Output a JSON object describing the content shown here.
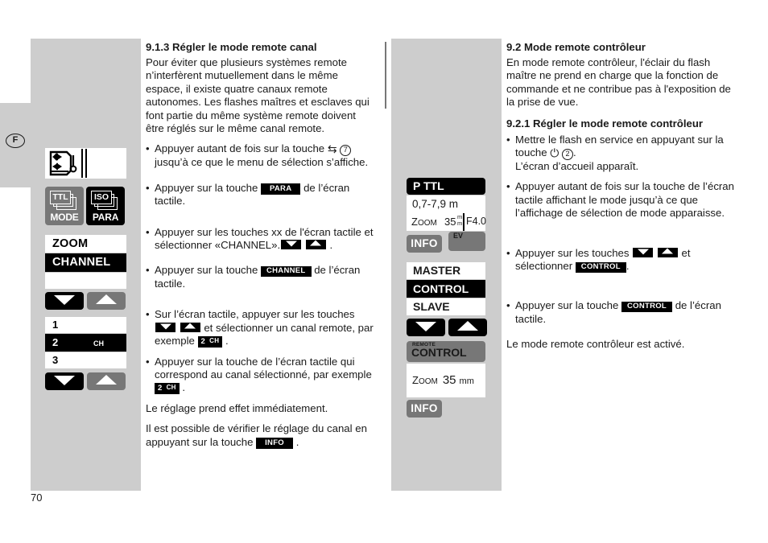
{
  "page": {
    "number": "70",
    "country_marker": "F"
  },
  "left_column": {
    "heading": "9.1.3  Régler le mode remote canal",
    "intro": "Pour éviter que plusieurs systèmes remote n’interfèrent mutuellement dans le même espace, il existe quatre canaux remote autonomes. Les flashes maîtres et esclaves qui font partie du même système remote doivent être réglés sur le même canal remote.",
    "bullet1_a": "Appuyer autant de fois sur la touche",
    "bullet1_sym": "⇆",
    "bullet1_num": "7",
    "bullet1_b": "jusqu’à ce que le menu de sélection s’affiche.",
    "bullet2_a": "Appuyer sur la touche",
    "bullet2_badge": "PARA",
    "bullet2_b": "de l’écran tactile.",
    "bullet3_a": "Appuyer sur les touches xx de l'écran tactile et sélectionner «CHANNEL».",
    "bullet3_b": ".",
    "bullet4_a": "Appuyer sur la touche",
    "bullet4_badge": "CHANNEL",
    "bullet4_b": "de l’écran tactile.",
    "bullet5_a": "Sur l’écran tactile, appuyer sur les touches",
    "bullet5_b": "et sélectionner un canal remote, par exemple",
    "bullet5_badge_num": "2",
    "bullet5_badge_ch": "CH",
    "bullet5_c": ".",
    "bullet6_a": "Appuyer sur la touche de l’écran tactile qui correspond au canal sélectionné, par exemple",
    "bullet6_badge_num": "2",
    "bullet6_badge_ch": "CH",
    "bullet6_b": ".",
    "closing1": "Le réglage prend effet immédiatement.",
    "closing2_a": "Il est possible de vérifier le réglage du canal en appuyant sur la touche",
    "closing2_badge": "INFO",
    "closing2_b": "."
  },
  "right_column": {
    "heading": "9.2 Mode remote contrôleur",
    "intro": "En mode remote contrôleur, l'éclair du flash maître ne prend en charge que la fonction de commande et ne contribue pas à l'exposition de la prise de vue.",
    "subheading": "9.2.1 Régler le mode remote contrôleur",
    "bullet1_a": "Mettre le flash en service en appuyant sur la touche",
    "bullet1_sym": "⏻",
    "bullet1_num": "2",
    "bullet1_b": ".",
    "bullet1_c": "L’écran d’accueil apparaît.",
    "bullet2": "Appuyer autant de fois sur la touche de l’écran tactile affichant le mode jusqu’à ce que l’affichage de sélection de mode apparaisse.",
    "bullet3_a": "Appuyer sur les touches",
    "bullet3_b": "et sélectionner",
    "bullet3_badge": "CONTROL",
    "bullet3_c": ".",
    "bullet4_a": "Appuyer sur la touche",
    "bullet4_badge": "CONTROL",
    "bullet4_b": "de l’écran tactile.",
    "closing": "Le mode remote contrôleur est activé."
  },
  "left_panel_lcd": {
    "reflector_icon_name": "reflector-zoom-icon",
    "mode_key": {
      "top": "TTL",
      "bottom": "MODE"
    },
    "para_key": {
      "top": "ISO",
      "bottom": "PARA"
    },
    "menu_list": [
      "ZOOM",
      "CHANNEL",
      ""
    ],
    "menu_selected": "CHANNEL",
    "channel_list": [
      "1",
      "2",
      "3"
    ],
    "channel_selected": "2",
    "channel_suffix": "CH"
  },
  "middle_panel_lcd": {
    "mode_bar": "P TTL",
    "distance": "0,7-7,9 m",
    "zoom_label": "Zoom",
    "zoom_value": "35",
    "zoom_unit_top": "m",
    "zoom_unit_bottom": "m",
    "aperture": "F4.0",
    "info_label": "INFO",
    "ev_label": "EV",
    "mode_list": [
      "MASTER",
      "CONTROL",
      "SLAVE"
    ],
    "mode_selected": "CONTROL",
    "remote_sup": "REMOTE",
    "remote_main": "CONTROL",
    "zoom2_label": "Zoom",
    "zoom2_value": "35",
    "zoom2_unit": "mm",
    "info_label2": "INFO"
  },
  "colors": {
    "panel_grey": "#cdcdcd",
    "key_grey": "#777777",
    "key_black": "#000000",
    "key_white": "#ffffff",
    "text": "#1a1a1a"
  }
}
